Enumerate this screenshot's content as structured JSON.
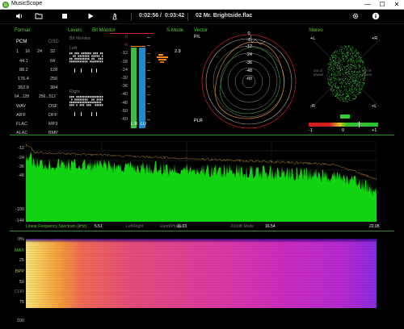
{
  "window": {
    "title": "MusicScope",
    "minimize": "—",
    "maximize": "☐",
    "close": "✕"
  },
  "toolbar": {
    "elapsed": "0:02:56",
    "separator": "/",
    "total": "0:03:42",
    "track": "02 Mr. Brightside.flac"
  },
  "format": {
    "title": "Format",
    "pcm": "PCM",
    "dsd": "DSD",
    "bit_depths": [
      "1",
      "16",
      "24",
      "32"
    ],
    "rates": [
      [
        "44.1",
        "64"
      ],
      [
        "88.2",
        "128"
      ],
      [
        "176.4",
        "256"
      ],
      [
        "352.8",
        "384"
      ],
      [
        "64...128",
        "256...512"
      ]
    ],
    "containers": [
      [
        "WAV",
        "DSF"
      ],
      [
        "AIFF",
        "DFF"
      ],
      [
        "FLAC",
        "MP3"
      ],
      [
        "ALAC",
        "BMP"
      ]
    ]
  },
  "levels": {
    "title": "Levels",
    "bit_monitor_title": "Bit Monitor",
    "bit_monitor_label": "Bit Monitor",
    "left": "Left",
    "right": "Right",
    "meter_labels": [
      "0",
      "-6",
      "-12",
      "-18",
      "-24",
      "-30",
      "-36",
      "-40",
      "-48",
      "-50",
      "-60"
    ],
    "channel_l": "L R",
    "channel_lu": "LU",
    "peak_value": "2.9"
  },
  "smode": {
    "title": "S-Mode"
  },
  "vector": {
    "title": "Vector",
    "ring_labels": [
      "0",
      "-6",
      "-12",
      "-24",
      "-36",
      "-48",
      "-60"
    ],
    "pl": "P/L",
    "plr": "PLR"
  },
  "stereo": {
    "title": "Stereo",
    "plus_l": "+L",
    "plus_r": "+R",
    "minus_l": "-R",
    "minus_r": "+L",
    "out_of_phase_l": "out of phase",
    "out_of_phase_r": "out of phase",
    "bar_min": "-1",
    "bar_mid": "0",
    "bar_max": "+1"
  },
  "spectrum": {
    "db_labels": [
      "-12",
      "-24",
      "-36",
      "-48",
      "-100",
      "-144"
    ],
    "tabs": [
      "Linear Frequency Spectrum (kHz)",
      "Left/Right",
      "Rand/Phase",
      "-200dB Mode"
    ],
    "freq_labels": [
      "5.51",
      "11.03",
      "16.54",
      "22.05"
    ]
  },
  "spectrogram": {
    "labels": [
      "0%",
      "MAX",
      "25",
      "BPP",
      "50",
      "COR",
      "75",
      "100"
    ]
  },
  "colors": {
    "accent": "#5ecb3f",
    "spectrum_fill": "#11d311",
    "meter_blue": "#1d8ccf",
    "meter_green": "#45b945"
  }
}
